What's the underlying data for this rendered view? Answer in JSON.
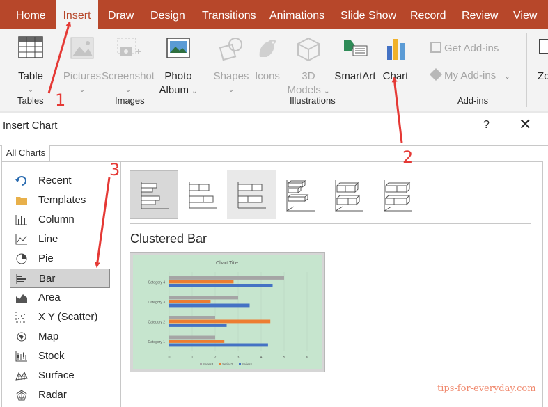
{
  "ribbon_tabs": [
    "Home",
    "Insert",
    "Draw",
    "Design",
    "Transitions",
    "Animations",
    "Slide Show",
    "Record",
    "Review",
    "View"
  ],
  "active_tab": "Insert",
  "ribbon": {
    "table": "Table",
    "tables_group": "Tables",
    "pictures": "Pictures",
    "screenshot": "Screenshot",
    "photo_album_1": "Photo",
    "photo_album_2": "Album",
    "images_group": "Images",
    "shapes": "Shapes",
    "icons": "Icons",
    "models_1": "3D",
    "models_2": "Models",
    "smartart": "SmartArt",
    "chart": "Chart",
    "illustrations_group": "Illustrations",
    "get_addins": "Get Add-ins",
    "my_addins": "My Add-ins",
    "addins_group": "Add-ins",
    "zoom_partial": "Zo"
  },
  "dialog": {
    "title": "Insert Chart",
    "help": "?",
    "close": "✕",
    "tab": "All Charts",
    "chart_types": [
      "Recent",
      "Templates",
      "Column",
      "Line",
      "Pie",
      "Bar",
      "Area",
      "X Y (Scatter)",
      "Map",
      "Stock",
      "Surface",
      "Radar"
    ],
    "selected_type": "Bar",
    "subtype_title": "Clustered Bar"
  },
  "preview_chart": {
    "title": "Chart Title",
    "categories": [
      "Category 1",
      "Category 2",
      "Category 3",
      "Category 4"
    ],
    "x_ticks": [
      "0",
      "1",
      "2",
      "3",
      "4",
      "5",
      "6"
    ],
    "legend": [
      "Series3",
      "Series2",
      "Series1"
    ]
  },
  "chart_data": {
    "type": "bar",
    "title": "Chart Title",
    "orientation": "horizontal",
    "categories": [
      "Category 1",
      "Category 2",
      "Category 3",
      "Category 4"
    ],
    "series": [
      {
        "name": "Series1",
        "values": [
          4.3,
          2.5,
          3.5,
          4.5
        ],
        "color": "#4472c4"
      },
      {
        "name": "Series2",
        "values": [
          2.4,
          4.4,
          1.8,
          2.8
        ],
        "color": "#ed7d31"
      },
      {
        "name": "Series3",
        "values": [
          2,
          2,
          3,
          5
        ],
        "color": "#a5a5a5"
      }
    ],
    "xlim": [
      0,
      6
    ],
    "grid": true,
    "legend_position": "bottom"
  },
  "annotations": [
    "1",
    "2",
    "3"
  ],
  "watermark": "tips-for-everyday.com",
  "colors": {
    "ribbon": "#b7472a",
    "annotation": "#e53935",
    "preview_bg": "#c6e5ce"
  }
}
